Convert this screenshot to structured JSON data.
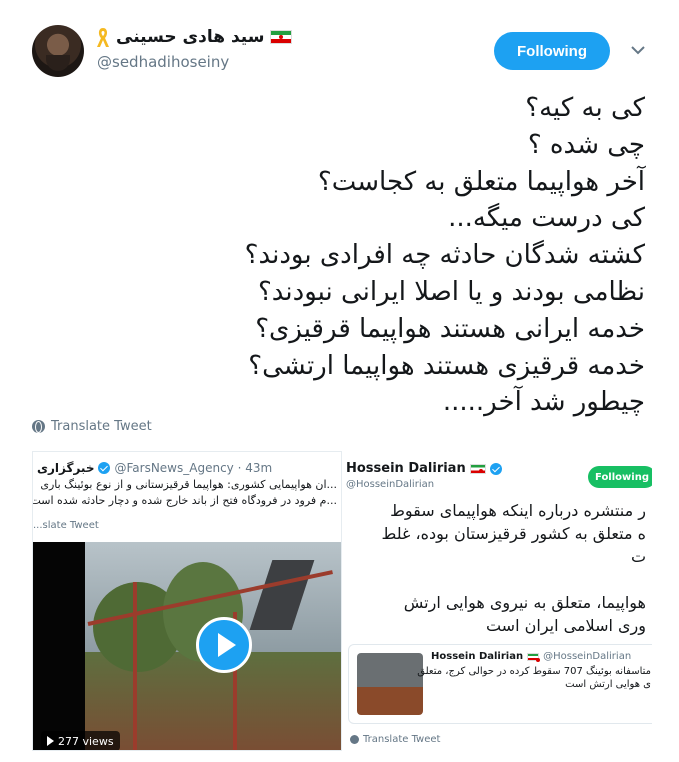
{
  "author": {
    "display_name": "سید هادی حسینی",
    "handle": "@sedhadihoseiny",
    "flag_icon": "iran-flag-icon",
    "ribbon_icon": "yellow-ribbon-icon",
    "ribbon_color": "#f5b921"
  },
  "follow_button": {
    "label": "Following",
    "color": "#1da1f2"
  },
  "tweet_lines": [
    "کی به کیه؟",
    "چی شده ؟",
    "آخر هواپیما متعلق به کجاست؟",
    "کی درست میگه...",
    "کشته شدگان حادثه چه افرادی بودند؟",
    "نظامی بودند و یا اصلا ایرانی نبودند؟",
    "خدمه ایرانی هستند هواپیما قرقیزی؟",
    "خدمه قرقیزی هستند هواپیما ارتشی؟",
    "چیطور شد آخر....."
  ],
  "translate_label": "Translate Tweet",
  "left_screenshot": {
    "agency_name": "خبرگزاری",
    "handle_time": "@FarsNews_Agency · 43m",
    "text_lines": [
      "...ان هواپیمایی کشوری: هواپیما قرقیزستانی و از نوع بوئینگ باری",
      "...م فرود در فرودگاه فتح از باند خارج شده و دچار حادثه شده است"
    ],
    "translate_label": "...slate Tweet",
    "views": "277 views"
  },
  "right_screenshot": {
    "name": "Hossein Dalirian",
    "handle": "@HosseinDalirian",
    "follow_label": "Following",
    "follow_color": "#17bf63",
    "text_lines": [
      "ر منتشره درباره اینکه هواپیمای سقوط",
      "ه متعلق به کشور قرقیزستان بوده، غلط",
      "ت",
      "",
      "هواپیما، متعلق به نیروی هوایی ارتش",
      "وری اسلامی ایران است"
    ],
    "quote": {
      "name": "Hossein Dalirian",
      "handle": "@HosseinDalirian",
      "text_lines": [
        "متاسفانه بوئینگ 707 سقوط کرده در حوالی کرج، متعلق",
        "ی هوایی ارتش است"
      ]
    },
    "translate_label": "Translate Tweet"
  }
}
